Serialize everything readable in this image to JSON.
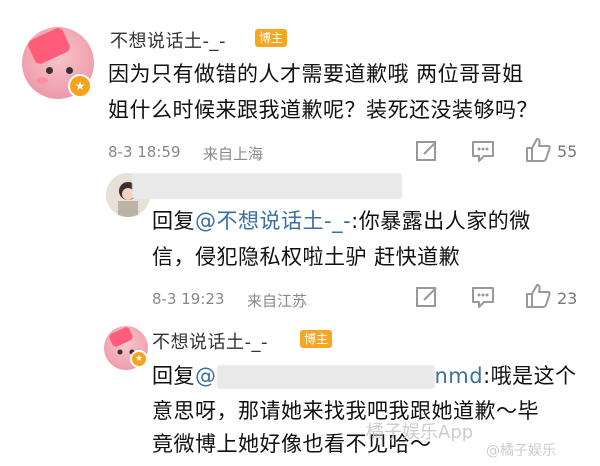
{
  "comment": {
    "username": "不想说话土-_-",
    "tag": "博主",
    "text_line1": "因为只有做错的人才需要道歉哦 两位哥哥姐",
    "text_line2": "姐什么时候来跟我道歉呢？装死还没装够吗？",
    "time": "8-3 18:59",
    "location": "来自上海",
    "like_count": "55"
  },
  "reply1": {
    "prefix": "回复",
    "mention": "@不想说话土-_-",
    "text_line1_rest": ":你暴露出人家的微",
    "text_line2": "信，侵犯隐私权啦土驴 赶快道歉",
    "time": "8-3 19:23",
    "location": "来自江苏",
    "like_count": "23"
  },
  "reply2": {
    "username": "不想说话土-_-",
    "tag": "博主",
    "prefix": "回复",
    "mention_start": "@",
    "mention_end": "nmd",
    "text_line1_rest": ":哦是这个",
    "text_line2": "意思呀，那请她来找我吧我跟她道歉～毕",
    "text_line3": "竟微博上她好像也看不见哈～"
  },
  "watermark": {
    "left": "橘子娱乐App",
    "right": "@橘子娱乐"
  },
  "icons": {
    "edit": "edit-icon",
    "comment": "comment-icon",
    "like": "thumbs-up-icon"
  },
  "colors": {
    "tag_bg": "#f5a623",
    "link": "#3a6ea5",
    "meta": "#888888"
  }
}
